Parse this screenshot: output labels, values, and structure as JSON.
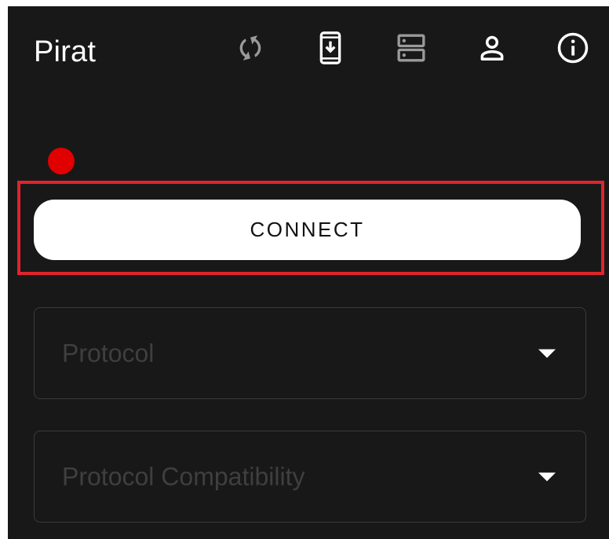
{
  "app": {
    "title": "Pirat"
  },
  "toolbar": {
    "icons": [
      {
        "name": "sync-icon",
        "color": "#9a9a9a"
      },
      {
        "name": "phone-download-icon",
        "color": "#ffffff"
      },
      {
        "name": "server-icon",
        "color": "#9a9a9a"
      },
      {
        "name": "person-icon",
        "color": "#ffffff"
      },
      {
        "name": "info-icon",
        "color": "#ffffff"
      }
    ]
  },
  "status": {
    "color": "#e00000"
  },
  "connect": {
    "label": "CONNECT"
  },
  "fields": {
    "protocol": {
      "label": "Protocol"
    },
    "compatibility": {
      "label": "Protocol Compatibility"
    }
  },
  "colors": {
    "background": "#181818",
    "highlight_border": "#e0242c",
    "button_bg": "#ffffff",
    "field_border": "#3a3a3a",
    "placeholder_text": "#3f3f3f"
  }
}
